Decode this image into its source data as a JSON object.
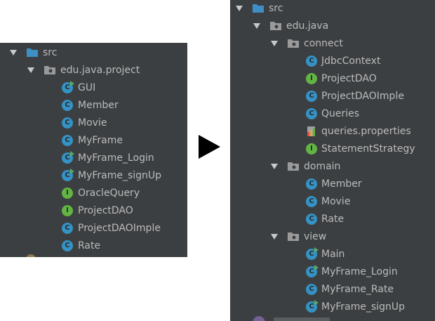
{
  "left_tree": {
    "root": "src",
    "package": "edu.java.project",
    "items": [
      {
        "label": "GUI",
        "kind": "c",
        "runnable": true
      },
      {
        "label": "Member",
        "kind": "c",
        "runnable": false
      },
      {
        "label": "Movie",
        "kind": "c",
        "runnable": false
      },
      {
        "label": "MyFrame",
        "kind": "c",
        "runnable": false
      },
      {
        "label": "MyFrame_Login",
        "kind": "c",
        "runnable": true
      },
      {
        "label": "MyFrame_signUp",
        "kind": "c",
        "runnable": true
      },
      {
        "label": "OracleQuery",
        "kind": "i",
        "runnable": false
      },
      {
        "label": "ProjectDAO",
        "kind": "i",
        "runnable": false
      },
      {
        "label": "ProjectDAOImple",
        "kind": "c",
        "runnable": false
      },
      {
        "label": "Rate",
        "kind": "c",
        "runnable": false
      }
    ]
  },
  "right_tree": {
    "root": "src",
    "package": "edu.java",
    "subpackages": [
      {
        "name": "connect",
        "items": [
          {
            "label": "JdbcContext",
            "kind": "c",
            "runnable": false
          },
          {
            "label": "ProjectDAO",
            "kind": "i",
            "runnable": false
          },
          {
            "label": "ProjectDAOImple",
            "kind": "c",
            "runnable": false
          },
          {
            "label": "Queries",
            "kind": "c",
            "runnable": false
          },
          {
            "label": "queries.properties",
            "kind": "props",
            "runnable": false
          },
          {
            "label": "StatementStrategy",
            "kind": "i",
            "runnable": false
          }
        ]
      },
      {
        "name": "domain",
        "items": [
          {
            "label": "Member",
            "kind": "c",
            "runnable": false
          },
          {
            "label": "Movie",
            "kind": "c",
            "runnable": false
          },
          {
            "label": "Rate",
            "kind": "c",
            "runnable": false
          }
        ]
      },
      {
        "name": "view",
        "items": [
          {
            "label": "Main",
            "kind": "c",
            "runnable": true
          },
          {
            "label": "MyFrame_Login",
            "kind": "c",
            "runnable": true
          },
          {
            "label": "MyFrame_Rate",
            "kind": "c",
            "runnable": false
          },
          {
            "label": "MyFrame_signUp",
            "kind": "c",
            "runnable": true
          }
        ]
      }
    ]
  },
  "icons": {
    "class": {
      "name": "class-icon",
      "letter": "C",
      "color": "#3592c4"
    },
    "interface": {
      "name": "interface-icon",
      "letter": "I",
      "color": "#62b543"
    },
    "properties": {
      "name": "properties-file-icon"
    },
    "folder_color": "#3d8fc5",
    "package_color": "#a9b7c6"
  },
  "transition_icon": "play-arrow-icon"
}
